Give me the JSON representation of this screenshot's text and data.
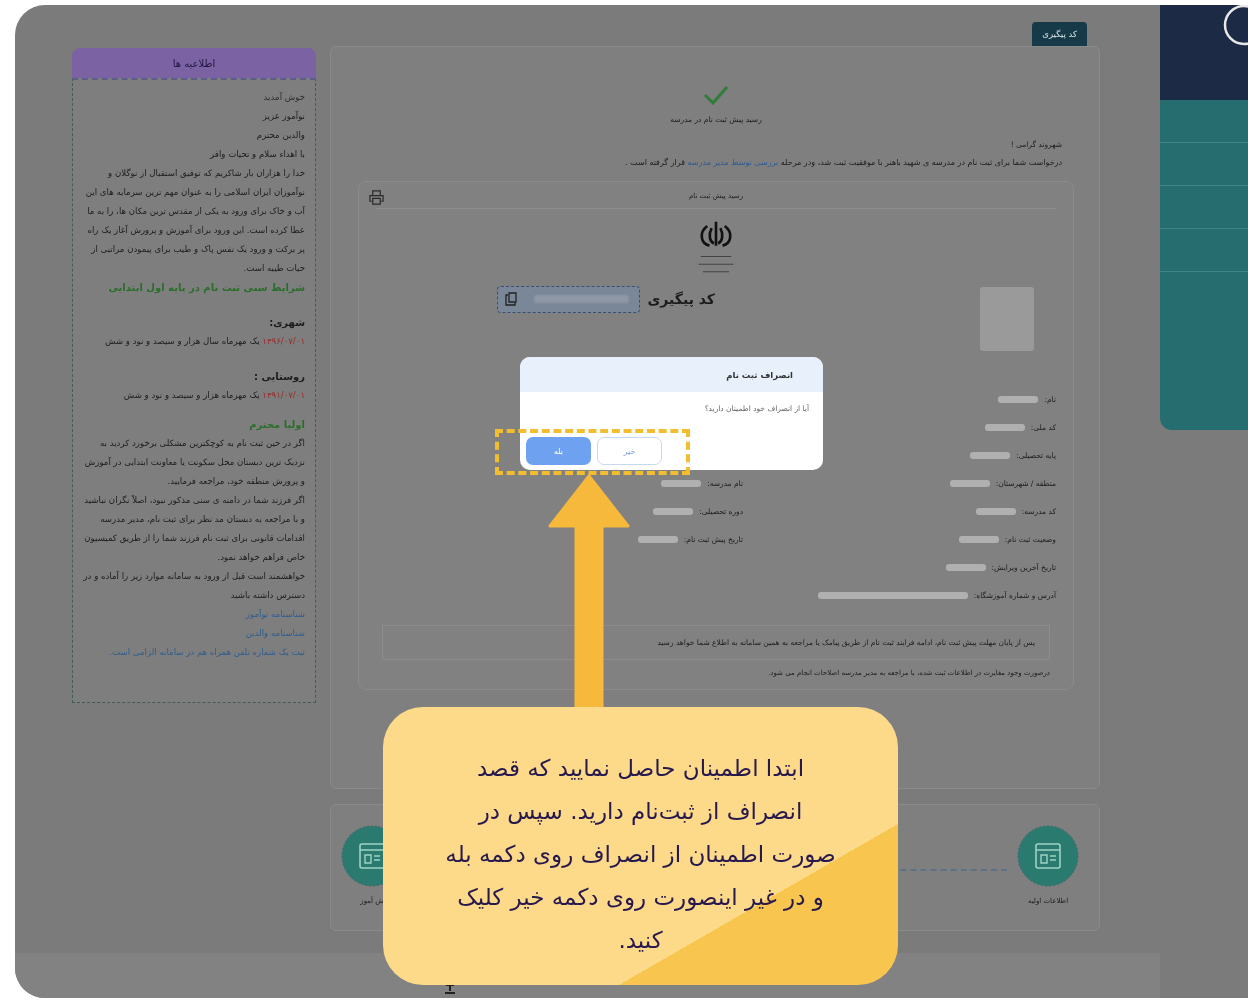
{
  "announcements": {
    "title": "اطلاعیه ها",
    "items": [
      {
        "kind": "muted",
        "text": "خوش آمدید"
      },
      {
        "kind": "plain",
        "text": "نوآموز عزیز"
      },
      {
        "kind": "plain",
        "text": "والدین محترم"
      },
      {
        "kind": "plain",
        "text": "با اهداء سلام و تحیات وافر"
      },
      {
        "kind": "plain",
        "text": "خدا را هزاران بار شاکریم که توفیق استقبال از نوگلان و نوآموزان ایران اسلامی را به عنوان مهم ترین سرمایه های این آب و خاک برای ورود به یکی از مقدس ترین مکان ها، را به ما عطا کرده است. این ورود برای آموزش و پرورش آغاز یک راه پر برکت و ورود یک نفس پاک و طیب برای پیمودن مراتبی از حیات طیبه است."
      },
      {
        "kind": "heading",
        "text": "شرایط سنی ثبت نام در پایه اول ابتدایی"
      },
      {
        "kind": "label",
        "text": "شهری:"
      },
      {
        "kind": "dated",
        "date": "۱۳۹۶/۰۷/۰۱",
        "text": "یک مهرماه سال هزار و سیصد و نود و شش"
      },
      {
        "kind": "label",
        "text": "روستایی :"
      },
      {
        "kind": "dated",
        "date": "۱۳۹۱/۰۷/۰۱",
        "text": "یک مهرماه هزار و سیصد و نود و شش"
      },
      {
        "kind": "heading",
        "text": "اولیا محترم"
      },
      {
        "kind": "plain",
        "text": "اگر در حین ثبت نام به کوچکترین مشکلی برخورد کردید به نزدیک ترین دبستان محل سکونت یا معاونت ابتدایی در آموزش و پرورش منطقه خود، مراجعه فرمایید."
      },
      {
        "kind": "plain",
        "text": "اگر فرزند شما در دامنه ی سنی مذکور نبود، اصلاً نگران نباشید و با مراجعه به دبستان مد نظر برای ثبت نام، مدیر مدرسه اقدامات قانونی برای ثبت نام فرزند شما را از طریق کمیسیون خاص فراهم خواهد نمود."
      },
      {
        "kind": "plain",
        "text": "خواهشمند است قبل از ورود به سامانه موارد زیر را آماده و در دسترس داشته باشید"
      },
      {
        "kind": "link",
        "text": "شناسنامه نوآموز"
      },
      {
        "kind": "link",
        "text": "شناسنامه والدین"
      },
      {
        "kind": "link",
        "text": "ثبت یک شماره تلفن همراه هم در سامانه الزامی است."
      }
    ]
  },
  "tab": {
    "label": "کد پیگیری"
  },
  "receipt": {
    "title": "رسید پیش ثبت نام در مدرسه",
    "greeting": "شهروند گرامی !",
    "message": {
      "before": "درخواست شما برای ثبت نام در مدرسه ی شهید باهنر با موفقیت ثبت شد، ودر مرحله ",
      "link": "بررسی توسط مدیر مدرسه",
      "after": " قرار گرفته است ."
    },
    "card": {
      "title": "رسید پیش ثبت نام",
      "tracking_label": "کد پیگیری",
      "rows": [
        {
          "right": {
            "label": "نام:"
          }
        },
        {
          "right": {
            "label": "کد ملی:"
          }
        },
        {
          "right": {
            "label": "پایه تحصیلی:"
          }
        },
        {
          "right": {
            "label": "منطقه / شهرستان:"
          },
          "left": {
            "label": "نام مدرسه:"
          }
        },
        {
          "right": {
            "label": "کد مدرسه:"
          },
          "left": {
            "label": "دوره تحصیلی:"
          }
        },
        {
          "right": {
            "label": "وضعیت ثبت نام:"
          },
          "left": {
            "label": "تاریخ پیش ثبت نام:"
          }
        },
        {
          "right": {
            "label": "تاریخ آخرین ویرایش:"
          }
        },
        {
          "right": {
            "label": "آدرس و شماره آموزشگاه:"
          }
        }
      ],
      "notice": "پس از پایان مهلت پیش ثبت نام، ادامه فرایند ثبت نام از طریق پیامک یا مراجعه به همین سامانه به اطلاع شما خواهد رسید",
      "footnote": "درصورت وجود مغایرت در اطلاعات ثبت شده، با مراجعه به مدیر مدرسه اصلاحات انجام می شود."
    }
  },
  "steps": [
    {
      "label": "اطلاعات اولیه"
    },
    {
      "label": "ش آموز"
    }
  ],
  "dialog": {
    "title": "انصراف ثبت نام",
    "message": "آیا از انصراف خود اطمینان دارید؟",
    "buttons": [
      {
        "label": "خیر",
        "kind": "secondary"
      },
      {
        "label": "بله",
        "kind": "primary"
      }
    ]
  },
  "tooltip": {
    "text": "ابتدا اطمینان حاصل نمایید که قصد انصراف از ثبت‌نام دارید. سپس در صورت اطمینان از انصراف  روی دکمه بله و در غیر اینصورت روی دکمه خیر کلیک کنید."
  }
}
